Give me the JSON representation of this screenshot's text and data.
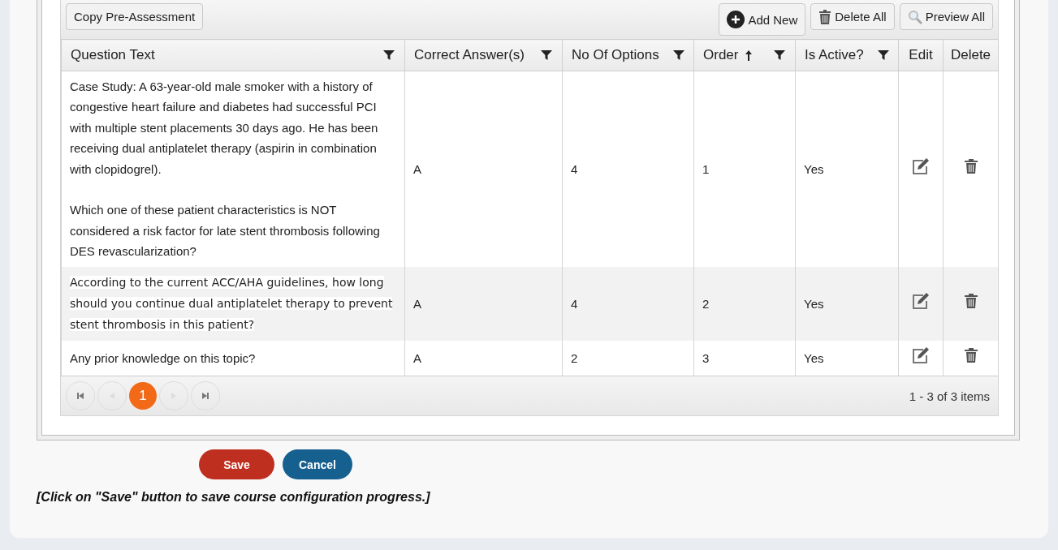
{
  "toolbar": {
    "left_buttons": [
      "Copy Pre-Assessment"
    ],
    "right_buttons": [
      {
        "kind": "add",
        "label": "Add New"
      },
      {
        "kind": "delete",
        "label": "Delete All"
      },
      {
        "kind": "preview",
        "label": "Preview All"
      }
    ]
  },
  "table": {
    "columns": [
      {
        "label": "Question Text",
        "filter": true,
        "sorted_ascending": false
      },
      {
        "label": "Correct Answer(s)",
        "filter": true,
        "sorted_ascending": false
      },
      {
        "label": "No Of Options",
        "filter": true,
        "sorted_ascending": false
      },
      {
        "label": "Order",
        "filter": true,
        "sorted_ascending": true
      },
      {
        "label": "Is Active?",
        "filter": true,
        "sorted_ascending": false
      },
      {
        "label": "Edit",
        "filter": false,
        "sorted_ascending": false
      },
      {
        "label": "Delete",
        "filter": false,
        "sorted_ascending": false
      }
    ],
    "rows": [
      {
        "question": "Case Study: A 63-year-old male smoker with a history of congestive heart failure and diabetes had successful PCI with multiple stent placements 30 days ago. He has been receiving dual antiplatelet therapy (aspirin in combination with clopidogrel).\n\nWhich one of these patient characteristics is NOT considered a risk factor for late stent thrombosis following DES revascularization?",
        "pasted": false,
        "answer": "A",
        "options": "4",
        "order": "1",
        "active": "Yes"
      },
      {
        "question": "According to the current ACC/AHA guidelines, how long should you continue dual antiplatelet therapy to prevent stent thrombosis in this patient?",
        "pasted": true,
        "answer": "A",
        "options": "4",
        "order": "2",
        "active": "Yes"
      },
      {
        "question": "Any prior knowledge on this topic?",
        "pasted": false,
        "answer": "A",
        "options": "2",
        "order": "3",
        "active": "Yes"
      }
    ]
  },
  "pager": {
    "pages": [
      {
        "label": "1",
        "selected": true
      }
    ],
    "summary": "1 - 3 of 3 items"
  },
  "actions": [
    {
      "kind": "primary",
      "label": "Save"
    },
    {
      "kind": "secondary",
      "label": "Cancel"
    }
  ],
  "note": "[Click on \"Save\" button to save course configuration progress.]"
}
